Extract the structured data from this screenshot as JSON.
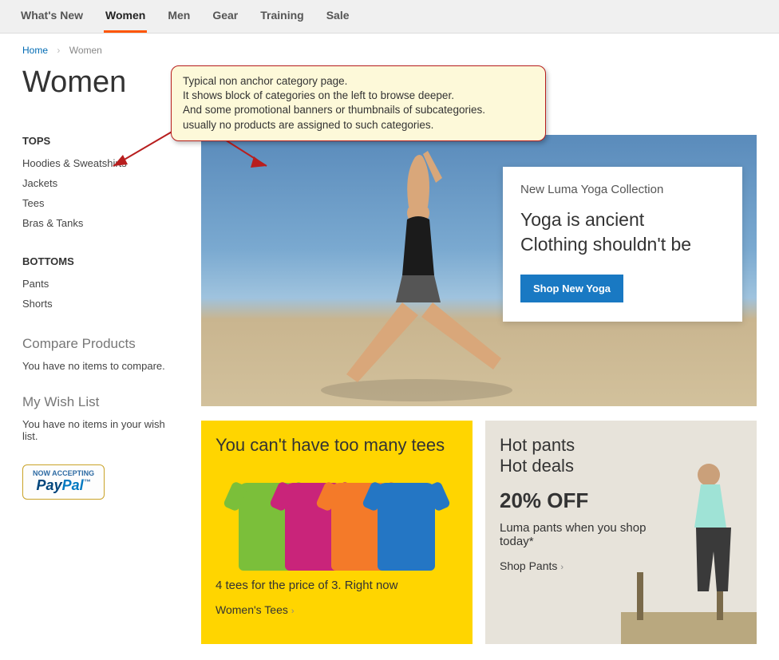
{
  "nav": {
    "items": [
      {
        "label": "What's New"
      },
      {
        "label": "Women"
      },
      {
        "label": "Men"
      },
      {
        "label": "Gear"
      },
      {
        "label": "Training"
      },
      {
        "label": "Sale"
      }
    ],
    "activeIndex": 1
  },
  "breadcrumb": {
    "home": "Home",
    "current": "Women"
  },
  "page": {
    "title": "Women"
  },
  "sidebar": {
    "groups": [
      {
        "heading": "Tops",
        "items": [
          "Hoodies & Sweatshirts",
          "Jackets",
          "Tees",
          "Bras & Tanks"
        ]
      },
      {
        "heading": "Bottoms",
        "items": [
          "Pants",
          "Shorts"
        ]
      }
    ],
    "compare": {
      "title": "Compare Products",
      "empty": "You have no items to compare."
    },
    "wishlist": {
      "title": "My Wish List",
      "empty": "You have no items in your wish list."
    },
    "paypal": {
      "line1": "NOW ACCEPTING",
      "pay": "Pay",
      "pal": "Pal"
    }
  },
  "hero": {
    "eyebrow": "New Luma Yoga Collection",
    "headline": "Yoga is ancient\nClothing shouldn't be",
    "cta": "Shop New Yoga"
  },
  "promo_tees": {
    "title": "You can't have too many tees",
    "sub": "4 tees for the price of 3. Right now",
    "link": "Women's Tees"
  },
  "promo_hot": {
    "title_line1": "Hot pants",
    "title_line2": "Hot deals",
    "pct": "20% OFF",
    "sub": "Luma pants when you shop today*",
    "link": "Shop Pants"
  },
  "callout": {
    "text": "Typical non anchor category page.\nIt shows block of categories on the left to browse deeper.\nAnd some promotional banners or thumbnails of subcategories.\nusually no products are assigned to such categories."
  }
}
